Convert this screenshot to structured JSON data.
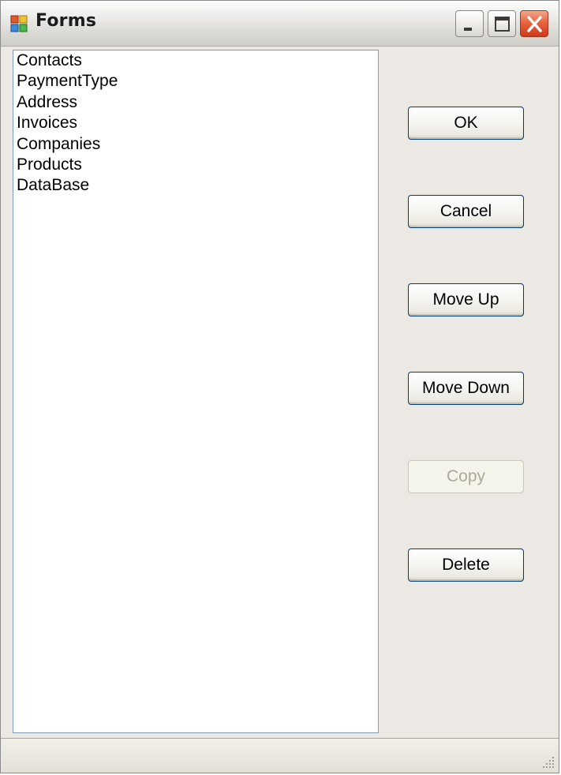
{
  "window": {
    "title": "Forms",
    "icon": "form-window-icon",
    "caption_buttons": [
      "minimize-icon",
      "maximize-icon",
      "close-icon"
    ]
  },
  "list": {
    "items": [
      "Contacts",
      "PaymentType",
      "Address",
      "Invoices",
      "Companies",
      "Products",
      "DataBase"
    ]
  },
  "buttons": {
    "ok": "OK",
    "cancel": "Cancel",
    "move_up": "Move Up",
    "move_down": "Move Down",
    "copy": "Copy",
    "delete": "Delete"
  },
  "states": {
    "copy_enabled": false
  },
  "colors": {
    "window_bg": "#ece9e4",
    "close_button": "#e8643e",
    "button_border": "#003c74",
    "disabled_text": "#aca899"
  }
}
